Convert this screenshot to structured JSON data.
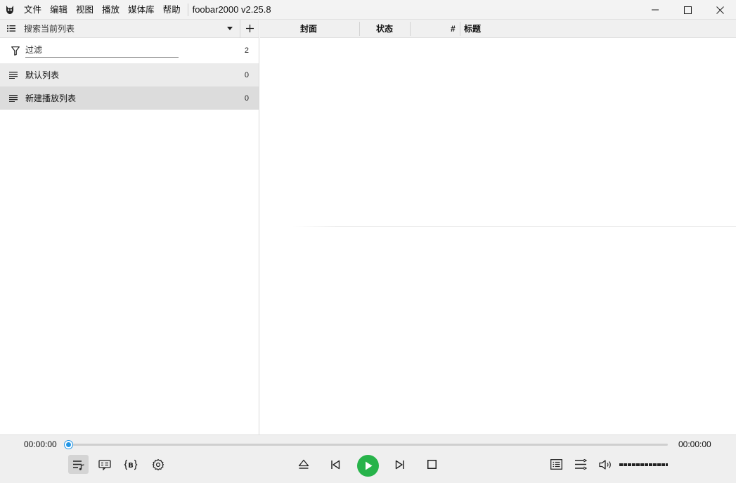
{
  "window": {
    "title": "foobar2000 v2.25.8",
    "menu": [
      "文件",
      "编辑",
      "视图",
      "播放",
      "媒体库",
      "帮助"
    ]
  },
  "sidebar": {
    "search_placeholder": "搜索当前列表",
    "filter": {
      "label": "过滤",
      "count": "2"
    },
    "playlists": [
      {
        "name": "默认列表",
        "count": "0"
      },
      {
        "name": "新建播放列表",
        "count": "0"
      }
    ]
  },
  "playlist_view": {
    "columns": [
      "封面",
      "状态",
      "#",
      "标题"
    ]
  },
  "playback": {
    "elapsed": "00:00:00",
    "total": "00:00:00",
    "progress": 0,
    "accent_color": "#2196e6",
    "play_color": "#27b34a"
  },
  "icons": {
    "left_controls": [
      "playlist-music-icon",
      "lyrics-icon",
      "bitrate-icon",
      "settings-icon"
    ],
    "center_controls": [
      "eject-icon",
      "previous-icon",
      "play-icon",
      "next-icon",
      "stop-icon"
    ],
    "right_controls": [
      "playlist-view-icon",
      "queue-icon",
      "volume-icon"
    ]
  }
}
